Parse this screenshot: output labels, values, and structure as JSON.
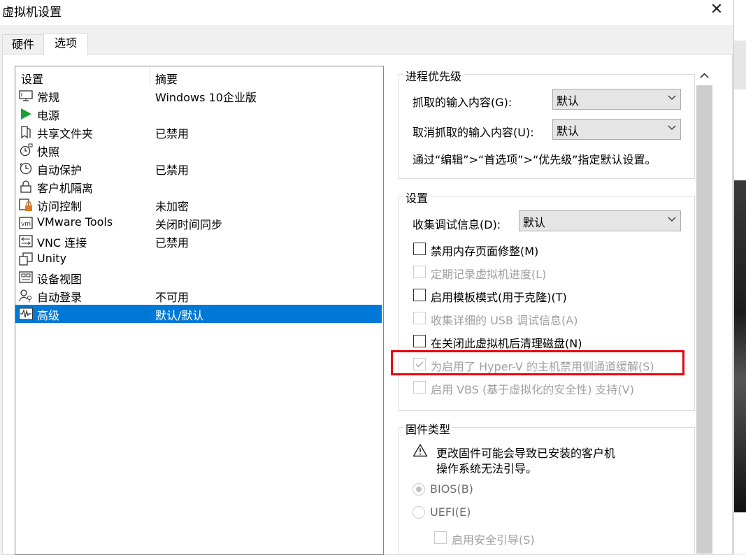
{
  "window": {
    "title": "虚拟机设置",
    "close_glyph": "✕"
  },
  "tabs": [
    {
      "label": "硬件"
    },
    {
      "label": "选项"
    }
  ],
  "list": {
    "col_setting": "设置",
    "col_summary": "摘要",
    "items": [
      {
        "name": "常规",
        "summary": "Windows 10企业版",
        "icon": "monitor-icon"
      },
      {
        "name": "电源",
        "summary": "",
        "icon": "play-icon"
      },
      {
        "name": "共享文件夹",
        "summary": "已禁用",
        "icon": "shared-folder-icon"
      },
      {
        "name": "快照",
        "summary": "",
        "icon": "snapshot-icon"
      },
      {
        "name": "自动保护",
        "summary": "已禁用",
        "icon": "clock-icon"
      },
      {
        "name": "客户机隔离",
        "summary": "",
        "icon": "lock-icon"
      },
      {
        "name": "访问控制",
        "summary": "未加密",
        "icon": "access-control-icon"
      },
      {
        "name": "VMware Tools",
        "summary": "关闭时间同步",
        "icon": "vm-icon"
      },
      {
        "name": "VNC 连接",
        "summary": "已禁用",
        "icon": "vnc-icon"
      },
      {
        "name": "Unity",
        "summary": "",
        "icon": "unity-icon"
      },
      {
        "name": "设备视图",
        "summary": "",
        "icon": "device-view-icon"
      },
      {
        "name": "自动登录",
        "summary": "不可用",
        "icon": "user-key-icon"
      },
      {
        "name": "高级",
        "summary": "默认/默认",
        "icon": "waveform-icon",
        "selected": true
      }
    ]
  },
  "process_priority": {
    "title": "进程优先级",
    "grab_label": "抓取的输入内容(G):",
    "grab_value": "默认",
    "ungrab_label": "取消抓取的输入内容(U):",
    "ungrab_value": "默认",
    "hint": "通过“编辑”>“首选项”>“优先级”指定默认设置。"
  },
  "settings": {
    "title": "设置",
    "debug_label": "收集调试信息(D):",
    "debug_value": "默认",
    "checkboxes": [
      {
        "label": "禁用内存页面修整(M)",
        "checked": false,
        "enabled": true
      },
      {
        "label": "定期记录虚拟机进度(L)",
        "checked": false,
        "enabled": false
      },
      {
        "label": "启用模板模式(用于克隆)(T)",
        "checked": false,
        "enabled": true
      },
      {
        "label": "收集详细的 USB 调试信息(A)",
        "checked": false,
        "enabled": false
      },
      {
        "label": "在关闭此虚拟机后清理磁盘(N)",
        "checked": false,
        "enabled": true
      },
      {
        "label": "为启用了 Hyper-V 的主机禁用侧通道缓解(S)",
        "checked": true,
        "enabled": false
      },
      {
        "label": "启用 VBS (基于虚拟化的安全性) 支持(V)",
        "checked": false,
        "enabled": false
      }
    ]
  },
  "firmware": {
    "title": "固件类型",
    "warning_line1": "更改固件可能会导致已安装的客户机",
    "warning_line2": "操作系统无法引导。",
    "bios_label": "BIOS(B)",
    "uefi_label": "UEFI(E)",
    "secure_boot_label": "启用安全引导(S)",
    "selected": "BIOS"
  },
  "colors": {
    "selection": "#0078d7",
    "highlight": "#e8000b",
    "disabled_text": "#a0a0a0"
  }
}
